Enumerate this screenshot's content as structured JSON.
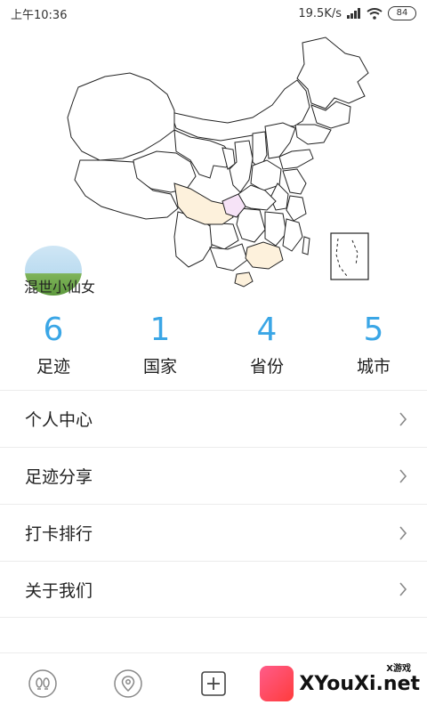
{
  "status_bar": {
    "time": "上午10:36",
    "speed": "19.5K/s",
    "battery": "84"
  },
  "profile": {
    "username": "混世小仙女"
  },
  "stats": [
    {
      "value": "6",
      "label": "足迹"
    },
    {
      "value": "1",
      "label": "国家"
    },
    {
      "value": "4",
      "label": "省份"
    },
    {
      "value": "5",
      "label": "城市"
    }
  ],
  "menu": [
    {
      "label": "个人中心"
    },
    {
      "label": "足迹分享"
    },
    {
      "label": "打卡排行"
    },
    {
      "label": "关于我们"
    }
  ],
  "bottom_nav": [
    {
      "icon": "footprint-icon"
    },
    {
      "icon": "location-pin-icon"
    },
    {
      "icon": "add-icon"
    }
  ],
  "watermark": {
    "site": "XYouXi.net",
    "tag": "X游戏"
  },
  "colors": {
    "accent": "#3aa6e6",
    "visited_province_a": "#fdf1dc",
    "visited_province_b": "#f6e3f7"
  }
}
